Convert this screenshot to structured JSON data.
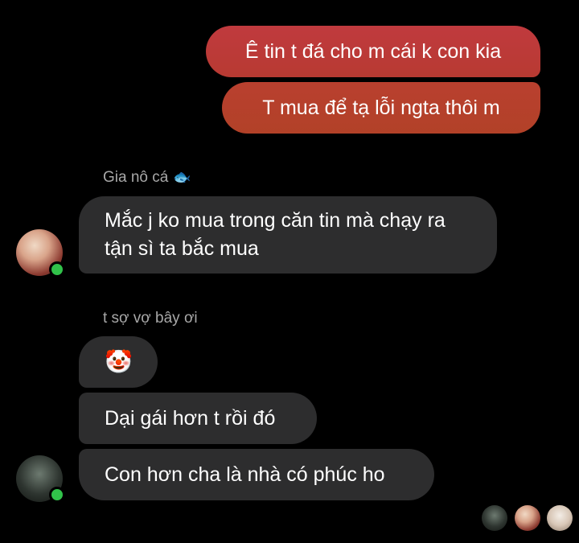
{
  "messages": {
    "outgoing": [
      {
        "text": "Ê tin t đá cho m cái k con kia"
      },
      {
        "text": "T mua để tạ lỗi ngta thôi m"
      }
    ],
    "group_1": {
      "sender": "Gia nô cá",
      "sender_emoji": "🐟",
      "messages": [
        {
          "text": "Mắc j ko mua trong căn tin mà chạy ra tận sì ta bắc mua"
        }
      ]
    },
    "group_2": {
      "sender": "t sợ vợ bây ơi",
      "messages": [
        {
          "text": "🤡"
        },
        {
          "text": "Dại gái hơn t rồi đó"
        },
        {
          "text": "Con hơn cha là nhà có phúc ho"
        }
      ]
    }
  },
  "colors": {
    "outgoing_bubble": "#c03a3e",
    "incoming_bubble": "#2d2d2e",
    "online": "#31c24a",
    "background": "#000000"
  }
}
